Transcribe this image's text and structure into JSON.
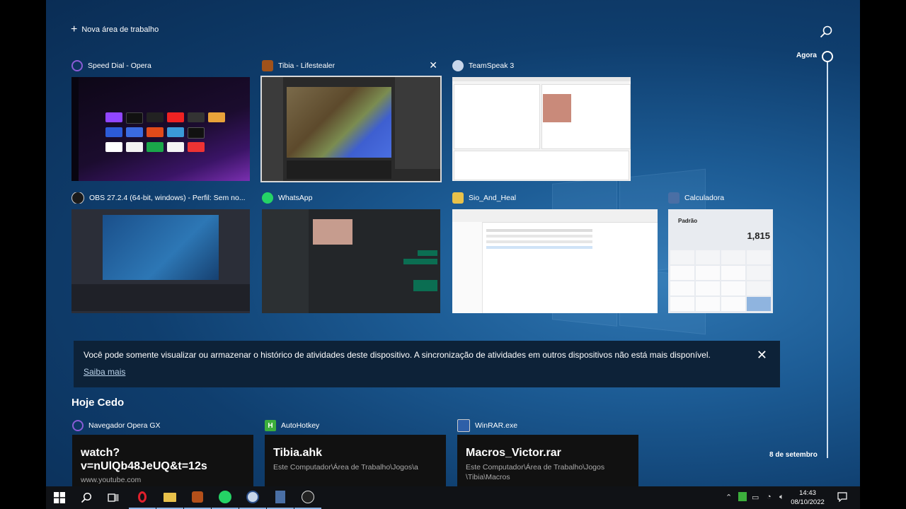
{
  "task_view": {
    "new_desktop_label": "Nova área de trabalho",
    "timeline_now": "Agora",
    "timeline_date": "8 de setembro"
  },
  "windows": [
    {
      "title": "Speed Dial - Opera",
      "icon": "opera-icon"
    },
    {
      "title": "Tibia - Lifestealer",
      "icon": "tibia-icon",
      "close": "✕"
    },
    {
      "title": "TeamSpeak 3",
      "icon": "teamspeak-icon"
    },
    {
      "title": "OBS 27.2.4 (64-bit, windows) - Perfil: Sem no...",
      "icon": "obs-icon"
    },
    {
      "title": "WhatsApp",
      "icon": "whatsapp-icon"
    },
    {
      "title": "Sio_And_Heal",
      "icon": "folder-icon"
    },
    {
      "title": "Calculadora",
      "icon": "calculator-icon",
      "display_value": "1,815",
      "mode": "Padrão"
    }
  ],
  "notice": {
    "text": "Você pode somente visualizar ou armazenar o histórico de atividades deste dispositivo. A sincronização de atividades em outros dispositivos não está mais disponível.",
    "link": "Saiba mais",
    "close": "✕"
  },
  "section_title": "Hoje Cedo",
  "activities": [
    {
      "app": "Navegador Opera GX",
      "title_line1": "watch?",
      "title_line2": "v=nUlQb48JeUQ&t=12s",
      "subtitle": "www.youtube.com"
    },
    {
      "app": "AutoHotkey",
      "title_line1": "Tibia.ahk",
      "subtitle": "Este Computador\\Área de Trabalho\\Jogos\\a"
    },
    {
      "app": "WinRAR.exe",
      "title_line1": "Macros_Victor.rar",
      "subtitle": "Este Computador\\Área de Trabalho\\Jogos",
      "subtitle2": "\\Tibia\\Macros"
    }
  ],
  "taskbar": {
    "time": "14:43",
    "date": "08/10/2022"
  },
  "colors": {
    "desktop": "#1c5b94",
    "notice_bg": "#0d2238",
    "taskbar": "#101216"
  }
}
